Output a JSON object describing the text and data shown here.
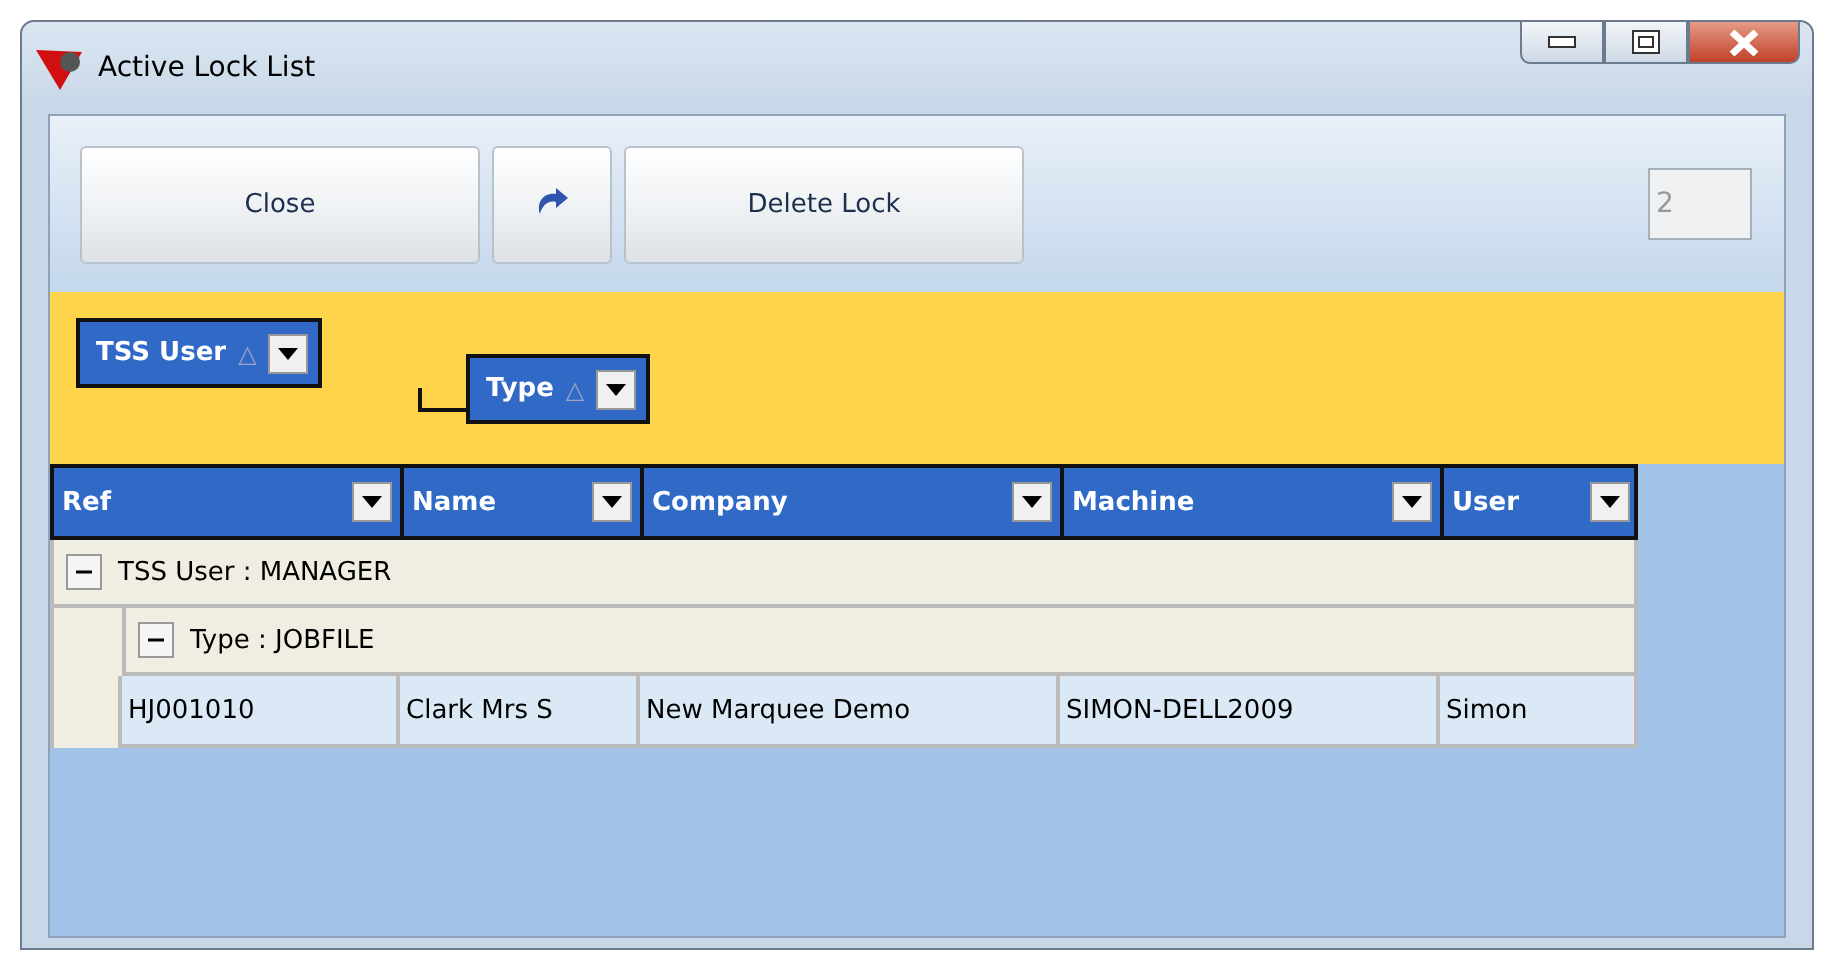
{
  "window": {
    "title": "Active Lock List"
  },
  "toolbar": {
    "buttons": [
      {
        "kind": "text",
        "label": "Close"
      },
      {
        "kind": "refresh"
      },
      {
        "kind": "text",
        "label": "Delete Lock"
      }
    ],
    "count_field": {
      "value": "2"
    }
  },
  "group_by": [
    {
      "label": "TSS User",
      "sort_mark": "△"
    },
    {
      "label": "Type",
      "sort_mark": "△"
    }
  ],
  "table": {
    "columns": [
      "Ref",
      "Name",
      "Company",
      "Machine",
      "User"
    ],
    "groups": [
      {
        "label": "TSS User : MANAGER",
        "expanded": true,
        "children": [
          {
            "label": "Type : JOBFILE",
            "expanded": true,
            "rows": [
              [
                "HJ001010",
                "Clark Mrs S",
                "New Marquee Demo",
                "SIMON-DELL2009",
                "Simon"
              ]
            ]
          }
        ]
      }
    ]
  }
}
